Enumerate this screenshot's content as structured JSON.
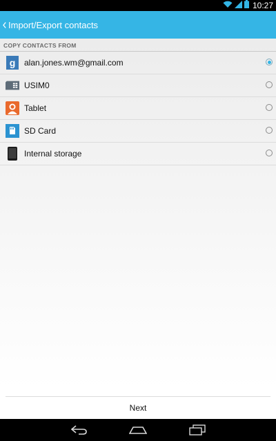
{
  "status_bar": {
    "time": "10:27",
    "icons": [
      "wifi-icon",
      "signal-icon",
      "battery-icon"
    ]
  },
  "action_bar": {
    "title": "Import/Export contacts",
    "back_icon": "chevron-left-icon",
    "background_color": "#35b5e5"
  },
  "section": {
    "header": "COPY CONTACTS FROM"
  },
  "sources": [
    {
      "label": "alan.jones.wm@gmail.com",
      "icon": "google-icon",
      "selected": true
    },
    {
      "label": "USIM0",
      "icon": "sim-card-icon",
      "selected": false
    },
    {
      "label": "Tablet",
      "icon": "tablet-contact-icon",
      "selected": false
    },
    {
      "label": "SD Card",
      "icon": "sd-card-icon",
      "selected": false
    },
    {
      "label": "Internal storage",
      "icon": "phone-storage-icon",
      "selected": false
    }
  ],
  "footer": {
    "next_label": "Next"
  },
  "nav_bar": {
    "buttons": [
      "back-icon",
      "home-icon",
      "recent-apps-icon"
    ]
  }
}
